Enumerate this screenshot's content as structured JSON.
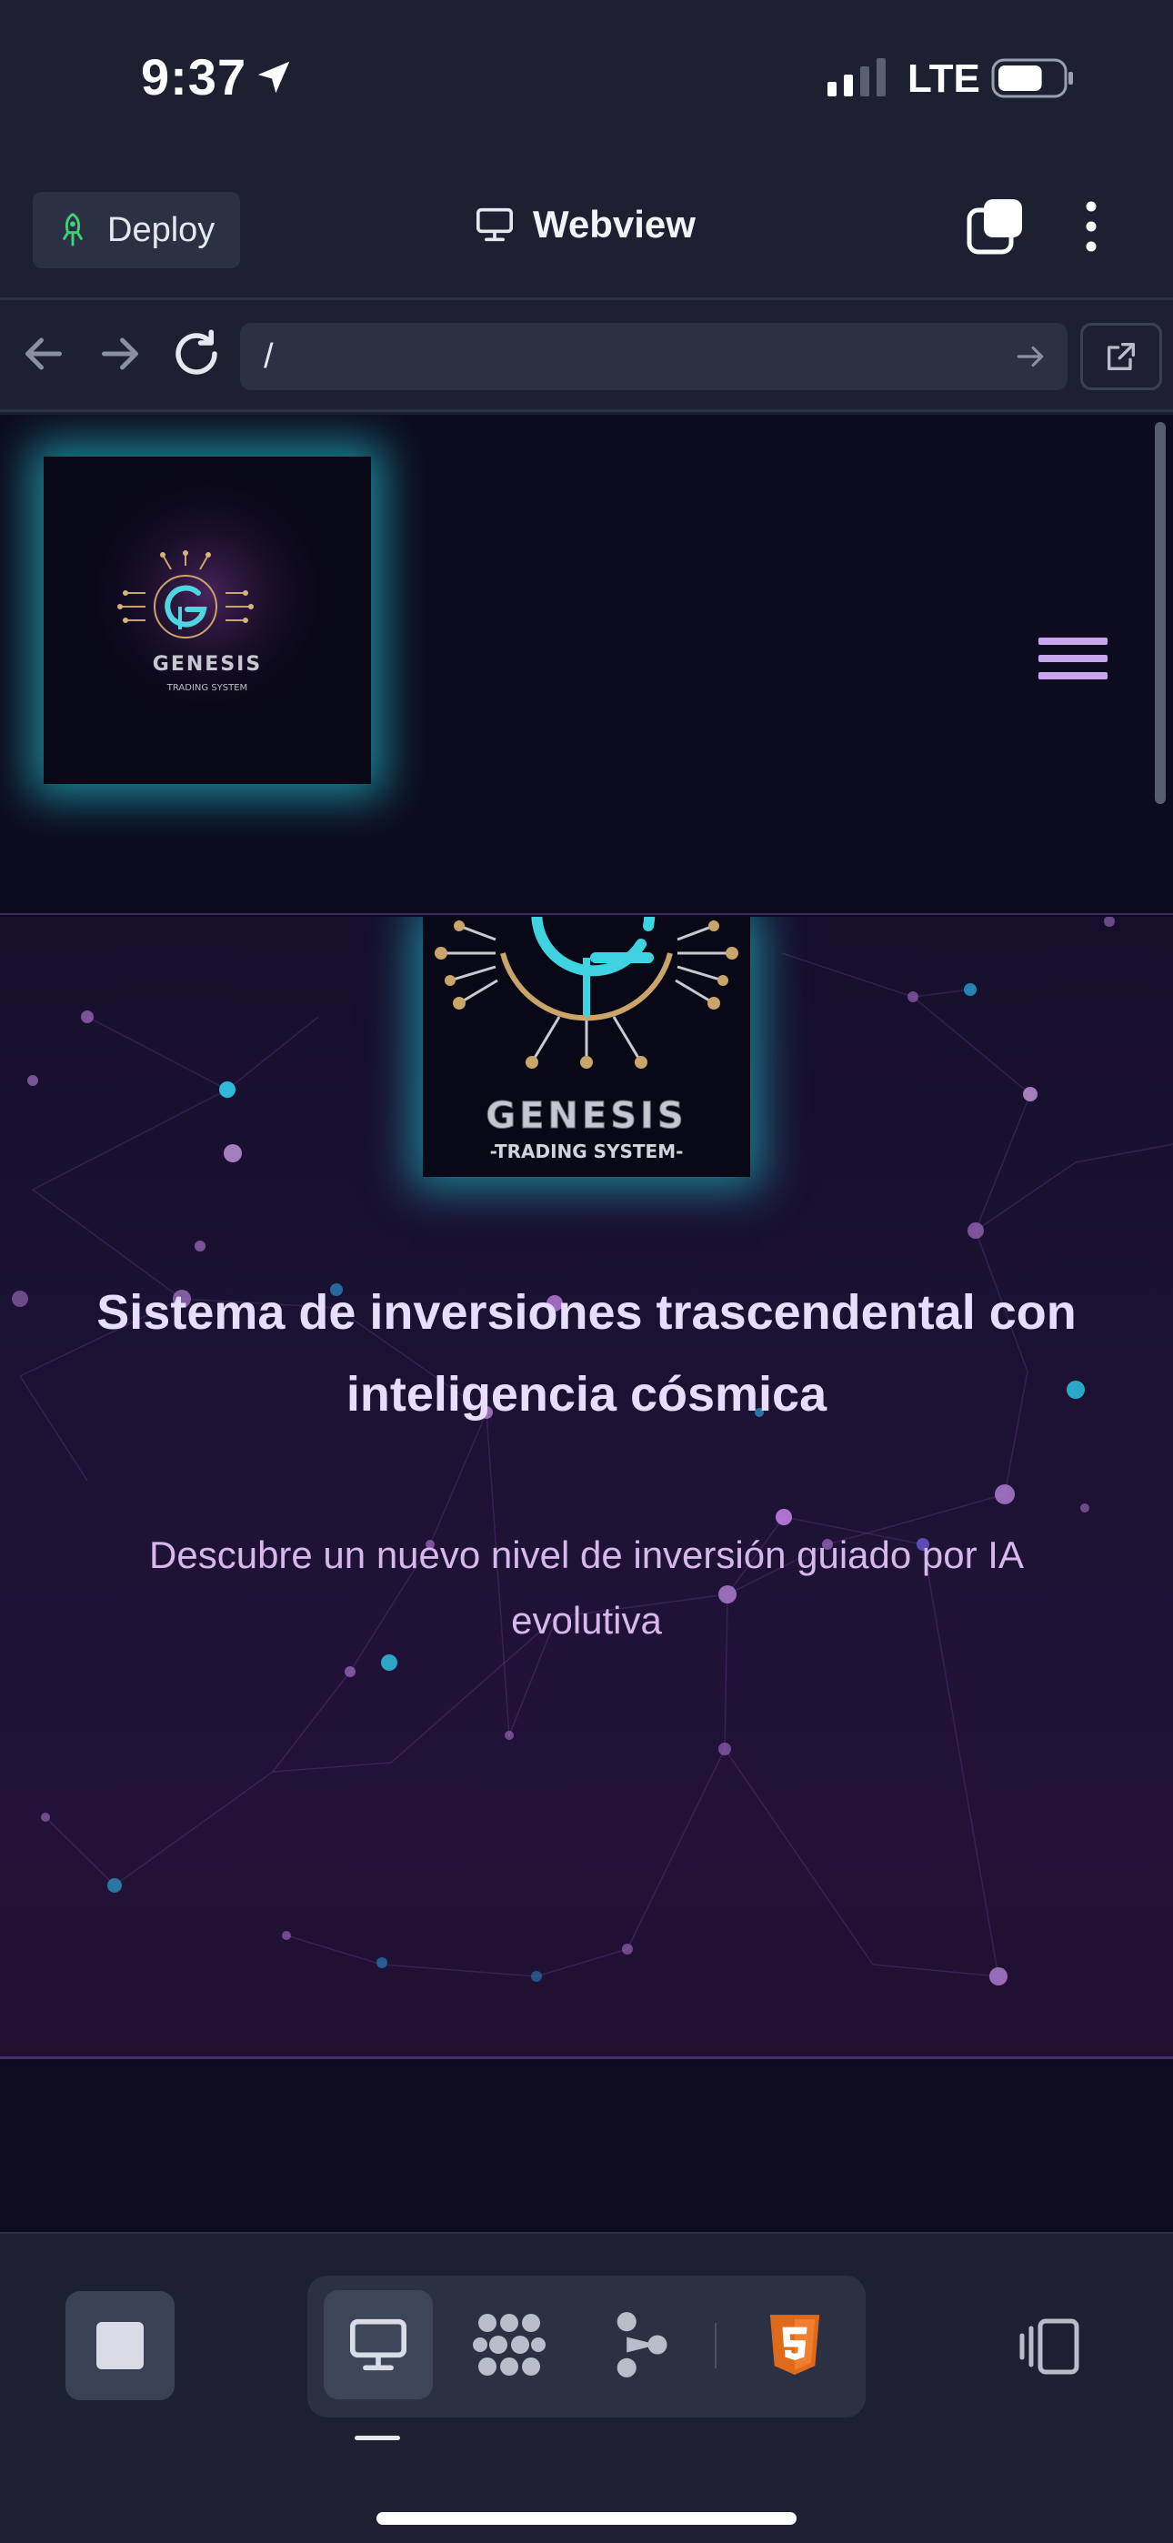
{
  "status_bar": {
    "time": "9:37",
    "network": "LTE",
    "battery_level": 0.7
  },
  "top_bar": {
    "deploy_label": "Deploy",
    "webview_label": "Webview"
  },
  "url_bar": {
    "url": "/"
  },
  "site": {
    "header_logo": {
      "brand": "GENESIS",
      "tagline": "TRADING SYSTEM"
    },
    "hero": {
      "logo": {
        "brand": "GENESIS",
        "tagline": "-TRADING SYSTEM-"
      },
      "title": "Sistema de inversiones trascendental con inteligencia cósmica",
      "subtitle": "Descubre un nuevo nivel de inversión guiado por IA evolutiva"
    }
  },
  "bottom_bar": {
    "tools": [
      "webview-icon",
      "extensions-icon",
      "agent-icon",
      "html5-icon"
    ],
    "active_tool": "webview-icon"
  },
  "colors": {
    "app_bg": "#1c2030",
    "site_bg": "#0d0b1f",
    "accent_purple": "#c7a6ee",
    "logo_glow": "#20b2be",
    "html5_orange": "#e06a1c"
  }
}
